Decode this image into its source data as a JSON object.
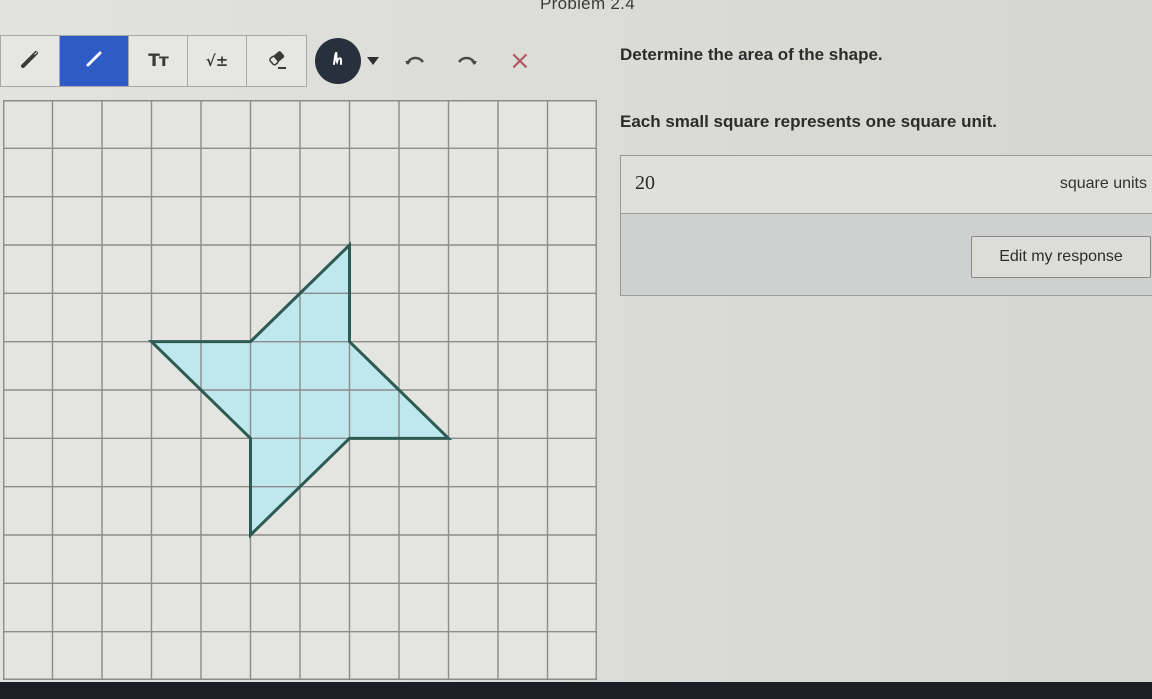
{
  "header": {
    "problem_title": "Problem 2.4"
  },
  "toolbar": {
    "tools": [
      {
        "name": "pencil",
        "icon": "pencil-icon",
        "active": false
      },
      {
        "name": "line",
        "icon": "line-segment-icon",
        "active": true
      },
      {
        "name": "text",
        "icon": "text-size-icon",
        "label": "Tт",
        "active": false
      },
      {
        "name": "math",
        "icon": "math-sqrt-icon",
        "label": "√±",
        "active": false
      },
      {
        "name": "eraser",
        "icon": "eraser-icon",
        "active": false
      }
    ],
    "color_button": {
      "icon": "scribble-icon",
      "color": "#27303c"
    },
    "undo_icon": "undo-icon",
    "redo_icon": "redo-icon",
    "clear_label": "×",
    "active_color": "#2f5bc4",
    "clear_color": "#b05a60"
  },
  "question": {
    "prompt": "Determine the area of the shape.",
    "instruction": "Each small square represents one square unit.",
    "answer_value": "20",
    "answer_unit": "square units",
    "edit_button_label": "Edit my response"
  },
  "grid": {
    "columns": 12,
    "rows": 12,
    "shape": {
      "fill": "#bfe7ee",
      "stroke": "#2d5a52",
      "vertices": [
        [
          7,
          3
        ],
        [
          7,
          5
        ],
        [
          9,
          7
        ],
        [
          7,
          7
        ],
        [
          5,
          9
        ],
        [
          5,
          7
        ],
        [
          3,
          5
        ],
        [
          5,
          5
        ]
      ]
    }
  }
}
